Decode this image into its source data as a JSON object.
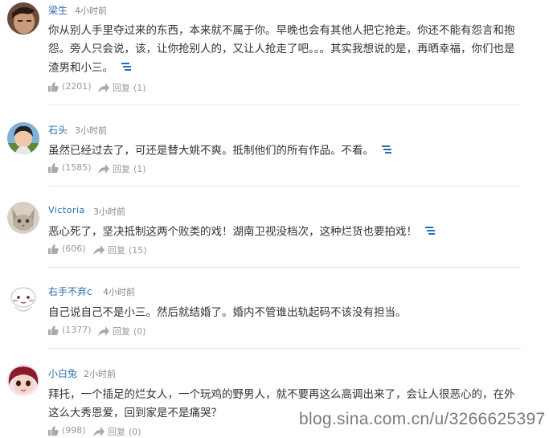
{
  "comments": [
    {
      "user": "梁生",
      "time": "4小时前",
      "text": "你从别人手里夺过来的东西，本来就不属于你。早晚也会有其他人把它抢走。你还不能有怨言和抱怨。旁人只会说，该，让你抢别人的，又让人抢走了吧。。。其实我想说的是，再晒幸福，你们也是渣男和小三。",
      "likes": "(2201)",
      "reply_label": "回复",
      "reply_count": "(1)"
    },
    {
      "user": "石头",
      "time": "3小时前",
      "text": "虽然已经过去了，可还是替大姚不爽。抵制他们的所有作品。不看。",
      "likes": "(1585)",
      "reply_label": "回复",
      "reply_count": "(1)"
    },
    {
      "user": "Victoria",
      "time": "3小时前",
      "text": "恶心死了，坚决抵制这两个败类的戏！湖南卫视没档次，这种烂货也要拍戏！",
      "likes": "(606)",
      "reply_label": "回复",
      "reply_count": "(15)"
    },
    {
      "user": "右手不弃c",
      "time": "4小时前",
      "text": "自己说自己不是小三。然后就结婚了。婚内不管谁出轨起码不该没有担当。",
      "likes": "(1377)",
      "reply_label": "回复",
      "reply_count": "(0)"
    },
    {
      "user": "小白兔",
      "time": "2小时前",
      "text": "拜托，一个插足的烂女人，一个玩鸡的野男人，就不要再这么高调出来了，会让人很恶心的，在外这么大秀恩爱，回到家是不是痛哭？",
      "likes": "(998)",
      "reply_label": "回复",
      "reply_count": "(0)"
    }
  ],
  "watermark": "blog.sina.com.cn/u/3266625397",
  "colors": {
    "link": "#2a6db3",
    "meta": "#999999",
    "divider": "#e6e6e6"
  },
  "icons": {
    "like": "thumbs-up-icon",
    "reply": "reply-arrow-icon",
    "expand": "expand-lines-icon"
  }
}
